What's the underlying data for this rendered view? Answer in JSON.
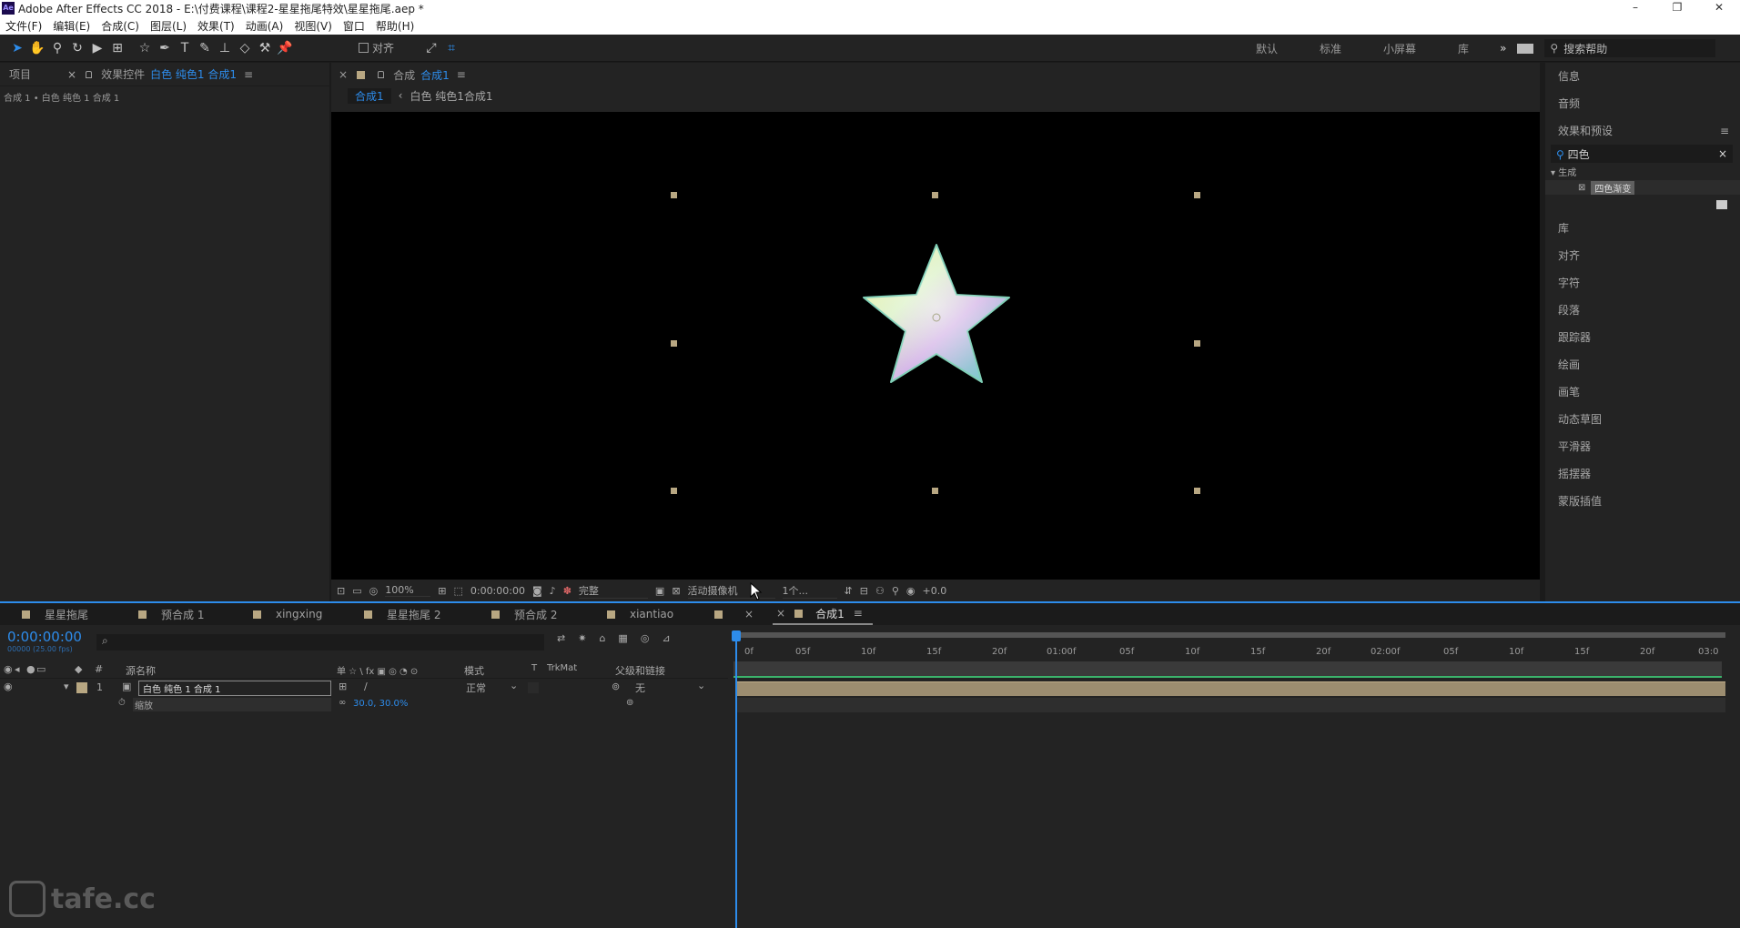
{
  "window": {
    "title": "Adobe After Effects CC 2018 - E:\\付费课程\\课程2-星星拖尾特效\\星星拖尾.aep *",
    "logo": "Ae",
    "minimize": "–",
    "restore": "❐",
    "close": "✕"
  },
  "menu": [
    "文件(F)",
    "编辑(E)",
    "合成(C)",
    "图层(L)",
    "效果(T)",
    "动画(A)",
    "视图(V)",
    "窗口",
    "帮助(H)"
  ],
  "toolbar": {
    "snap_label": "对齐",
    "workspaces": [
      "默认",
      "标准",
      "小屏幕",
      "库"
    ],
    "more": "»",
    "search_placeholder": "搜索帮助"
  },
  "project_panel": {
    "tab_project": "项目",
    "tab_effects": "效果控件",
    "tab_effects_target": "白色 纯色1 合成1",
    "menu_icon": "≡",
    "breadcrumb": "合成 1 • 白色 纯色 1 合成 1"
  },
  "comp_panel": {
    "close": "×",
    "tab_prefix": "合成",
    "tab_name": "合成1",
    "menu_icon": "≡",
    "crumb_1": "合成1",
    "crumb_sep": "‹",
    "crumb_2": "白色 纯色1合成1"
  },
  "viewer_controls": {
    "zoom": "100%",
    "timecode": "0:00:00:00",
    "resolution": "完整",
    "camera": "活动摄像机",
    "views": "1个...",
    "exposure": "+0.0"
  },
  "right_panel": {
    "info": "信息",
    "audio": "音频",
    "effects_presets": "效果和预设",
    "menu_icon": "≡",
    "search_value": "四色",
    "clear": "×",
    "tree_group": "▾ 生成",
    "tree_item": "四色渐变",
    "items": [
      "库",
      "对齐",
      "字符",
      "段落",
      "跟踪器",
      "绘画",
      "画笔",
      "动态草图",
      "平滑器",
      "摇摆器",
      "蒙版插值"
    ]
  },
  "timeline": {
    "tabs": [
      "星星拖尾",
      "预合成 1",
      "xingxing",
      "星星拖尾 2",
      "预合成 2",
      "xiantiao",
      "×"
    ],
    "active_tab": "合成1",
    "active_close": "×",
    "active_menu": "≡",
    "current_time": "0:00:00:00",
    "time_sub": "00000 (25.00 fps)",
    "search_icon": "⌕",
    "columns": {
      "num": "#",
      "source": "源名称",
      "switches": "单 ☆ \\ fx ▣ ◎ ◔ ⊙",
      "mode": "模式",
      "t": "T",
      "trkmat": "TrkMat",
      "parent": "父级和链接"
    },
    "layer": {
      "index": "1",
      "name": "白色 纯色 1 合成 1",
      "mode": "正常",
      "parent": "无"
    },
    "property": {
      "name": "缩放",
      "value": "30.0, 30.0%"
    },
    "ruler": [
      "0f",
      "05f",
      "10f",
      "15f",
      "20f",
      "01:00f",
      "05f",
      "10f",
      "15f",
      "20f",
      "02:00f",
      "05f",
      "10f",
      "15f",
      "20f",
      "03:0"
    ]
  },
  "watermark": "tafe.cc",
  "colors": {
    "accent": "#2d8ceb",
    "label": "#b8a782",
    "panel": "#232323"
  }
}
